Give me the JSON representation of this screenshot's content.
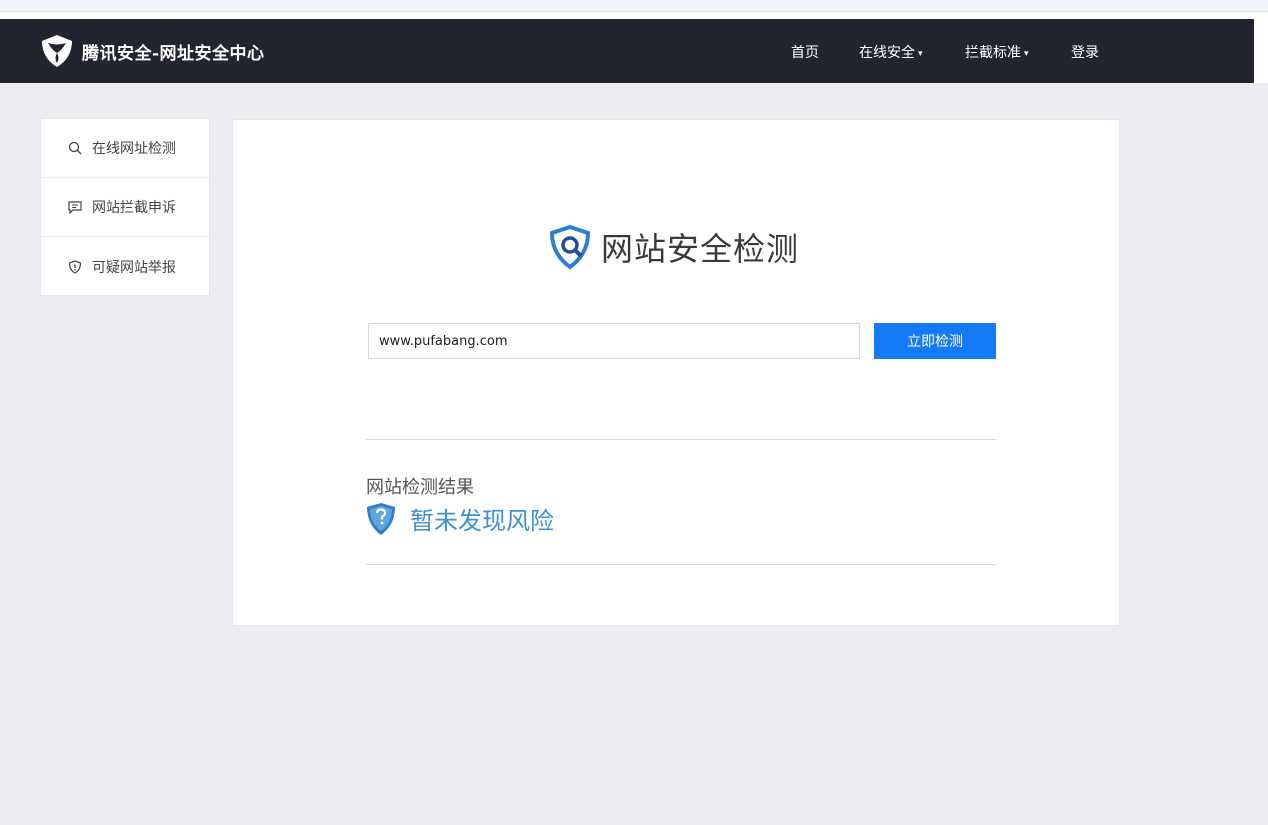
{
  "header": {
    "brand": "腾讯安全-网址安全中心",
    "nav": [
      {
        "label": "首页",
        "has_dropdown": false
      },
      {
        "label": "在线安全",
        "has_dropdown": true
      },
      {
        "label": "拦截标准",
        "has_dropdown": true
      },
      {
        "label": "登录",
        "has_dropdown": false
      }
    ],
    "caret": "▾"
  },
  "sidebar": {
    "items": [
      {
        "label": "在线网址检测",
        "icon": "search-icon"
      },
      {
        "label": "网站拦截申诉",
        "icon": "chat-icon"
      },
      {
        "label": "可疑网站举报",
        "icon": "shield-alert-icon"
      }
    ]
  },
  "main": {
    "title": "网站安全检测",
    "url_input_value": "www.pufabang.com",
    "check_button": "立即检测",
    "result_label": "网站检测结果",
    "result_text": "暂未发现风险"
  },
  "colors": {
    "topbar": "#22242f",
    "accent_button": "#157af6",
    "result_text": "#3d8fd6"
  }
}
